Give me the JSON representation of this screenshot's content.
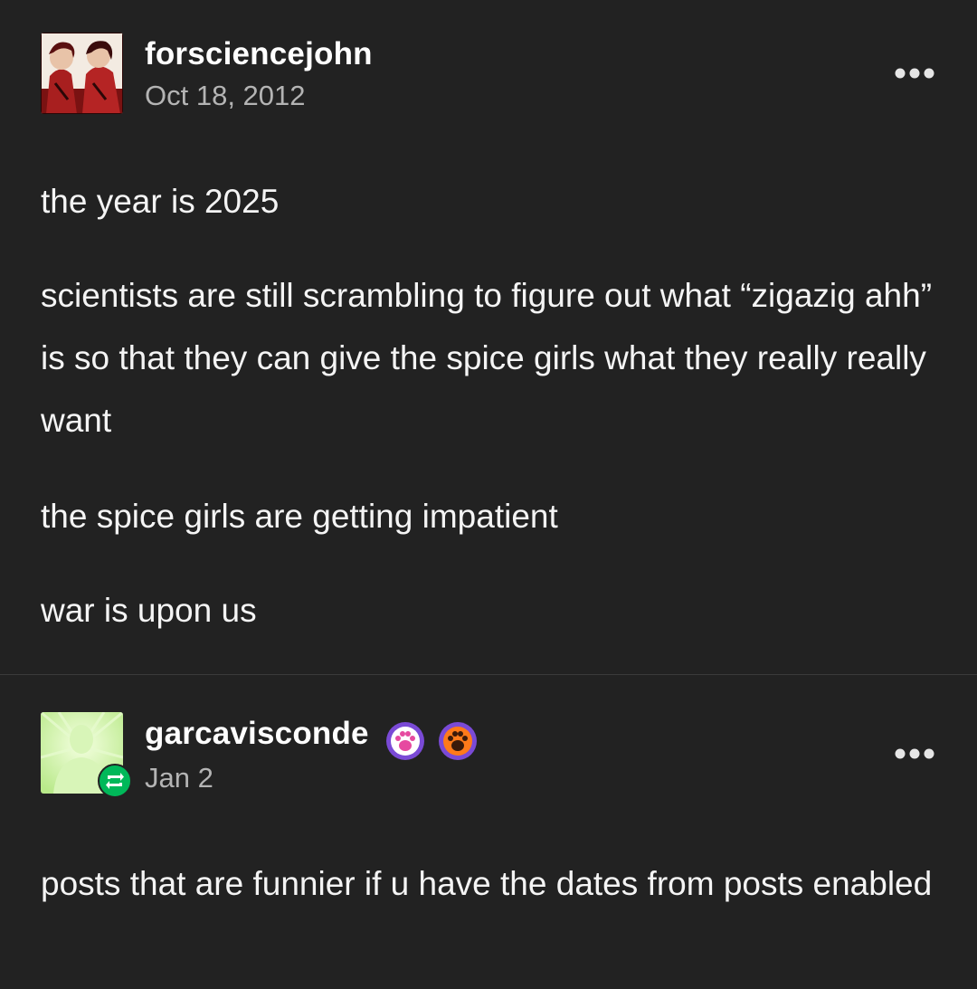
{
  "posts": [
    {
      "username": "forsciencejohn",
      "date": "Oct 18, 2012",
      "paragraphs": [
        "the year is 2025",
        "scientists are still scrambling to figure out what “zigazig ahh” is so that they can give the spice girls what they really really want",
        "the spice girls are getting impatient",
        "war is upon us"
      ],
      "avatar_icon": "illustrated-avatar-icon",
      "menu_icon": "more-dots-icon"
    },
    {
      "username": "garcavisconde",
      "date": "Jan 2",
      "paragraphs": [
        "posts that are funnier if u have the dates from posts enabled"
      ],
      "avatar_icon": "default-person-avatar-icon",
      "badges": [
        "paw-badge-pink-icon",
        "paw-badge-orange-icon"
      ],
      "reblog_icon": "reblog-icon",
      "menu_icon": "more-dots-icon"
    }
  ],
  "colors": {
    "background": "#222222",
    "text": "#f4f4f4",
    "muted": "#b4b4b4",
    "reblog_green": "#00b859",
    "badge_pink": "#e64aa0",
    "badge_orange": "#ff7a1a",
    "badge_purple": "#7a4ad6"
  }
}
